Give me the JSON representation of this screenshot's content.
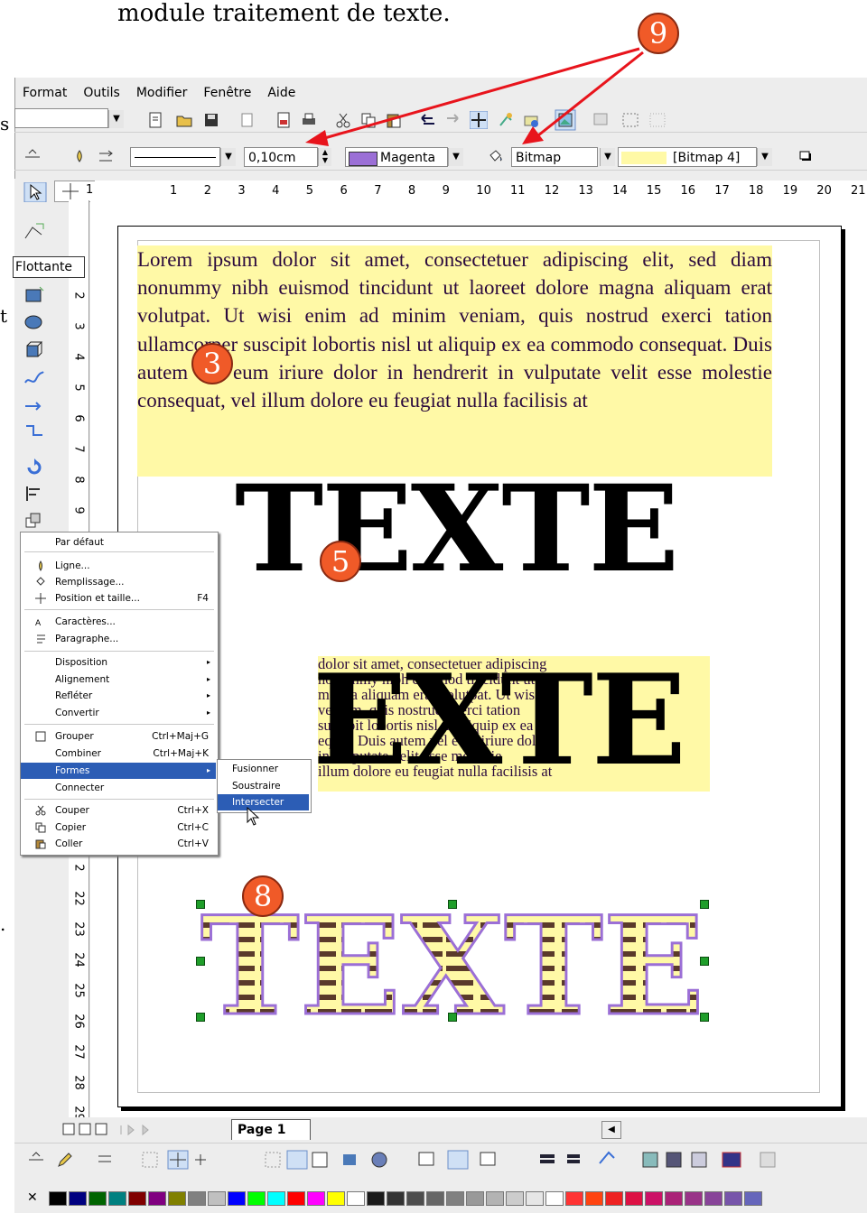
{
  "heading": "module traitement de texte.",
  "menu": [
    "Format",
    "Outils",
    "Modifier",
    "Fenêtre",
    "Aide"
  ],
  "line_bar": {
    "width_value": "0,10cm",
    "color_value": "Magenta",
    "fill_type": "Bitmap",
    "bitmap_value": "[Bitmap 4]"
  },
  "ruler_h": [
    "1",
    "1",
    "2",
    "3",
    "4",
    "5",
    "6",
    "7",
    "8",
    "9",
    "10",
    "11",
    "12",
    "13",
    "14",
    "15",
    "16",
    "17",
    "18",
    "19",
    "20",
    "21"
  ],
  "ruler_v_top": [
    "2",
    "3",
    "4",
    "5",
    "6",
    "7",
    "8",
    "9"
  ],
  "ruler_v_bottom": [
    "2",
    "22",
    "23",
    "24",
    "25",
    "26",
    "27",
    "28",
    "29"
  ],
  "tooltip": "Flottante",
  "lorem": "Lorem ipsum dolor sit amet, consectetuer adipiscing elit, sed diam nonummy nibh euismod tincidunt ut laoreet dolore magna aliquam erat volutpat. Ut wisi enim ad minim veniam, quis nostrud exerci tation ullamcorper suscipit lobortis nisl ut aliquip ex ea commodo consequat. Duis autem vel eum iriure dolor in hendrerit in vulputate velit esse molestie consequat, vel illum dolore eu feugiat nulla facilisis at",
  "big_word": "TEXTE",
  "intersect_word": "EXTE",
  "intersect_lines": [
    "dolor sit amet, consectetuer adipiscing",
    "nonummy nibh euismod tincidunt ut",
    "magna aliquam erat volutpat. Ut wisi",
    "veniam, quis nostrud exerci tation",
    "suscipit lobortis nisl ut aliquip ex ea",
    "equat. Duis autem vel eum iriure dolor",
    "in vulputate velit esse molestie",
    "illum dolore eu feugiat nulla facilisis at"
  ],
  "badges": [
    "9",
    "3",
    "5",
    "8"
  ],
  "context_menu": [
    {
      "label": "Par défaut",
      "shortcut": ""
    },
    {
      "label": "Ligne...",
      "shortcut": ""
    },
    {
      "label": "Remplissage...",
      "shortcut": ""
    },
    {
      "label": "Position et taille...",
      "shortcut": "F4"
    },
    {
      "label": "Caractères...",
      "shortcut": ""
    },
    {
      "label": "Paragraphe...",
      "shortcut": ""
    },
    {
      "label": "Disposition",
      "shortcut": ""
    },
    {
      "label": "Alignement",
      "shortcut": ""
    },
    {
      "label": "Refléter",
      "shortcut": ""
    },
    {
      "label": "Convertir",
      "shortcut": ""
    },
    {
      "label": "Grouper",
      "shortcut": "Ctrl+Maj+G"
    },
    {
      "label": "Combiner",
      "shortcut": "Ctrl+Maj+K"
    },
    {
      "label": "Formes",
      "shortcut": ""
    },
    {
      "label": "Connecter",
      "shortcut": ""
    },
    {
      "label": "Couper",
      "shortcut": "Ctrl+X"
    },
    {
      "label": "Copier",
      "shortcut": "Ctrl+C"
    },
    {
      "label": "Coller",
      "shortcut": "Ctrl+V"
    }
  ],
  "submenu": [
    "Fusionner",
    "Soustraire",
    "Intersecter"
  ],
  "page_tab": "Page 1",
  "colors": {
    "accent": "#2c5db5",
    "highlight": "#fff9a6",
    "badge": "#f05a28",
    "arrow": "#e8141c",
    "magenta": "#9b6fd6"
  },
  "palette": [
    "#000000",
    "#000080",
    "#006400",
    "#008080",
    "#800000",
    "#800080",
    "#808000",
    "#808080",
    "#c0c0c0",
    "#0000ff",
    "#00ff00",
    "#00ffff",
    "#ff0000",
    "#ff00ff",
    "#ffff00",
    "#ffffff",
    "#1a1a1a",
    "#333333",
    "#4d4d4d",
    "#666666",
    "#808080",
    "#999999",
    "#b3b3b3",
    "#cccccc",
    "#e6e6e6",
    "#ffffff",
    "#ff3333",
    "#ff4411",
    "#ee2222",
    "#dd1144",
    "#cc1166",
    "#aa2277",
    "#993388",
    "#884499",
    "#7755aa",
    "#6666bb"
  ]
}
